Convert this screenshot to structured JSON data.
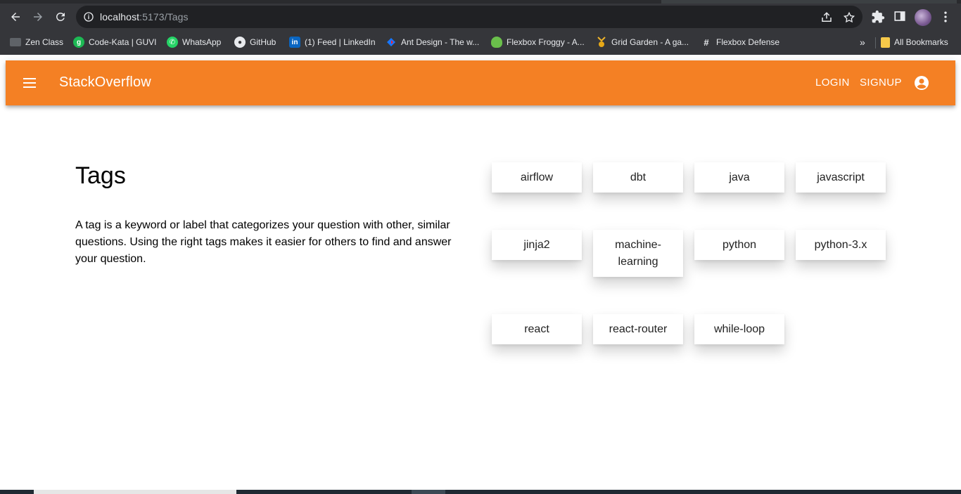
{
  "browser": {
    "url_host": "localhost",
    "url_path": ":5173/Tags",
    "bookmarks": [
      {
        "label": "Zen Class",
        "icon": "generic-page-icon"
      },
      {
        "label": "Code-Kata | GUVI",
        "icon": "guvi-icon"
      },
      {
        "label": "WhatsApp",
        "icon": "whatsapp-icon"
      },
      {
        "label": "GitHub",
        "icon": "github-icon"
      },
      {
        "label": "(1) Feed | LinkedIn",
        "icon": "linkedin-icon"
      },
      {
        "label": "Ant Design - The w...",
        "icon": "ant-design-icon"
      },
      {
        "label": "Flexbox Froggy - A...",
        "icon": "froggy-icon"
      },
      {
        "label": "Grid Garden - A ga...",
        "icon": "grid-garden-icon"
      },
      {
        "label": "Flexbox Defense",
        "icon": "flexbox-defense-icon"
      }
    ],
    "more_bookmarks": "»",
    "all_bookmarks": "All Bookmarks"
  },
  "appbar": {
    "brand": "StackOverflow",
    "login": "LOGIN",
    "signup": "SIGNUP",
    "color": "#f48024"
  },
  "page": {
    "title": "Tags",
    "description": "A tag is a keyword or label that categorizes your question with other, similar questions. Using the right tags makes it easier for others to find and answer your question."
  },
  "tags": [
    "airflow",
    "dbt",
    "java",
    "javascript",
    "jinja2",
    "machine-learning",
    "python",
    "python-3.x",
    "react",
    "react-router",
    "while-loop"
  ]
}
